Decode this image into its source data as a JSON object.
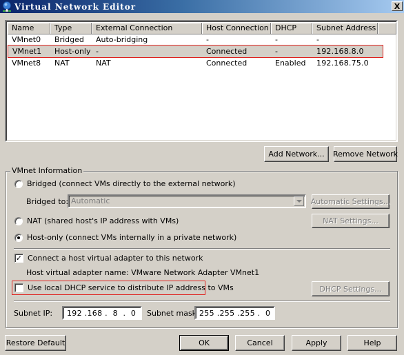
{
  "window": {
    "title": "Virtual Network Editor",
    "icon": "network-globe-icon",
    "close_label": "X"
  },
  "table": {
    "columns": [
      "Name",
      "Type",
      "External Connection",
      "Host Connection",
      "DHCP",
      "Subnet Address"
    ],
    "rows": [
      [
        "VMnet0",
        "Bridged",
        "Auto-bridging",
        "-",
        "-",
        "-"
      ],
      [
        "VMnet1",
        "Host-only",
        "-",
        "Connected",
        "-",
        "192.168.8.0"
      ],
      [
        "VMnet8",
        "NAT",
        "NAT",
        "Connected",
        "Enabled",
        "192.168.75.0"
      ]
    ],
    "selected_row": 1
  },
  "list_buttons": {
    "add_network": "Add Network...",
    "remove_network": "Remove Network"
  },
  "vmnet_info": {
    "group_label": "VMnet Information",
    "bridged_label": "Bridged (connect VMs directly to the external network)",
    "bridged_to_label": "Bridged to:",
    "bridged_to_value": "Automatic",
    "automatic_settings": "Automatic Settings...",
    "nat_label": "NAT (shared host's IP address with VMs)",
    "nat_settings": "NAT Settings...",
    "host_only_label": "Host-only (connect VMs internally in a private network)",
    "selected_mode": "host-only",
    "connect_adapter_label": "Connect a host virtual adapter to this network",
    "connect_adapter_checked": true,
    "adapter_name_text": "Host virtual adapter name: VMware Network Adapter VMnet1",
    "dhcp_label": "Use local DHCP service to distribute IP address to VMs",
    "dhcp_checked": false,
    "dhcp_settings": "DHCP Settings...",
    "subnet_ip_label": "Subnet IP:",
    "subnet_ip_value": "192 .168 .  8  .  0",
    "subnet_mask_label": "Subnet mask:",
    "subnet_mask_value": "255 .255 .255 .  0"
  },
  "footer": {
    "restore_default": "Restore Default",
    "ok": "OK",
    "cancel": "Cancel",
    "apply": "Apply",
    "help": "Help"
  },
  "colors": {
    "highlight_border": "#e0201c",
    "title_gradient_start": "#0a246a",
    "title_gradient_end": "#a6caf0",
    "dialog_bg": "#d4d0c8"
  }
}
